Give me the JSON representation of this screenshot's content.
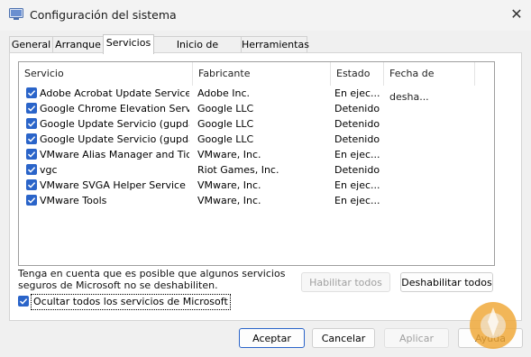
{
  "window": {
    "title": "Configuración del sistema",
    "close_glyph": "✕"
  },
  "tabs": [
    {
      "label": "General",
      "active": false
    },
    {
      "label": "Arranque",
      "active": false
    },
    {
      "label": "Servicios",
      "active": true
    },
    {
      "label": "Inicio de Windows",
      "active": false
    },
    {
      "label": "Herramientas",
      "active": false
    }
  ],
  "services": {
    "columns": {
      "service": "Servicio",
      "manufacturer": "Fabricante",
      "status": "Estado",
      "date": "Fecha de desha..."
    },
    "rows": [
      {
        "name": "Adobe Acrobat Update Service",
        "manufacturer": "Adobe Inc.",
        "status": "En ejec...",
        "checked": true
      },
      {
        "name": "Google Chrome Elevation Servic...",
        "manufacturer": "Google LLC",
        "status": "Detenido",
        "checked": true
      },
      {
        "name": "Google Update Servicio (gupdate)",
        "manufacturer": "Google LLC",
        "status": "Detenido",
        "checked": true
      },
      {
        "name": "Google Update Servicio (gupdat...",
        "manufacturer": "Google LLC",
        "status": "Detenido",
        "checked": true
      },
      {
        "name": "VMware Alias Manager and Ticke...",
        "manufacturer": "VMware, Inc.",
        "status": "En ejec...",
        "checked": true
      },
      {
        "name": "vgc",
        "manufacturer": "Riot Games, Inc.",
        "status": "Detenido",
        "checked": true
      },
      {
        "name": "VMware SVGA Helper Service",
        "manufacturer": "VMware, Inc.",
        "status": "En ejec...",
        "checked": true
      },
      {
        "name": "VMware Tools",
        "manufacturer": "VMware, Inc.",
        "status": "En ejec...",
        "checked": true
      }
    ]
  },
  "note": "Tenga en cuenta que es posible que algunos servicios seguros de Microsoft no se deshabiliten.",
  "buttons": {
    "enable_all": "Habilitar todos",
    "disable_all": "Deshabilitar todos",
    "ok": "Aceptar",
    "cancel": "Cancelar",
    "apply": "Aplicar",
    "help": "Ayuda"
  },
  "hide_microsoft": {
    "label": "Ocultar todos los servicios de Microsoft",
    "checked": true
  },
  "colors": {
    "accent": "#2a64c9",
    "logo": "#f0a93b"
  },
  "icons": {
    "app": "system-config-icon",
    "check": "checkmark-icon",
    "close": "close-icon",
    "logo": "watermark-logo"
  }
}
